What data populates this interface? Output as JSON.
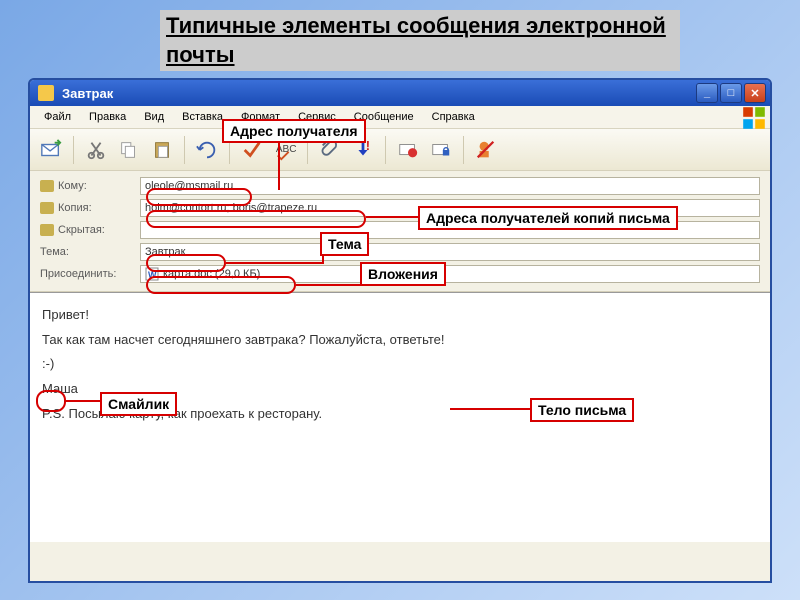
{
  "slide": {
    "title": "Типичные элементы сообщения электронной почты"
  },
  "window": {
    "title": "Завтрак"
  },
  "menu": {
    "file": "Файл",
    "edit": "Правка",
    "view": "Вид",
    "insert": "Вставка",
    "format": "Формат",
    "service": "Сервис",
    "message": "Сообщение",
    "help": "Справка"
  },
  "fields": {
    "to_label": "Кому:",
    "to_value": "oleole@msmail.ru",
    "cc_label": "Копия:",
    "cc_value": "holm@contort.ru; boris@trapeze.ru",
    "bcc_label": "Скрытая:",
    "bcc_value": "",
    "subject_label": "Тема:",
    "subject_value": "Завтрак",
    "attach_label": "Присоединить:",
    "attach_value": "карта.doc (29,0 КБ)"
  },
  "body": {
    "l1": "Привет!",
    "l2": "Так как там насчет сегодняшнего завтрака? Пожалуйста, ответьте!",
    "l3": ":-)",
    "l4": "Маша",
    "l5": "P.S. Посылаю карту, как проехать к ресторану."
  },
  "callouts": {
    "recipient": "Адрес получателя",
    "cc_recipients": "Адреса получателей копий письма",
    "subject": "Тема",
    "attachments": "Вложения",
    "smiley": "Смайлик",
    "body": "Тело письма"
  }
}
